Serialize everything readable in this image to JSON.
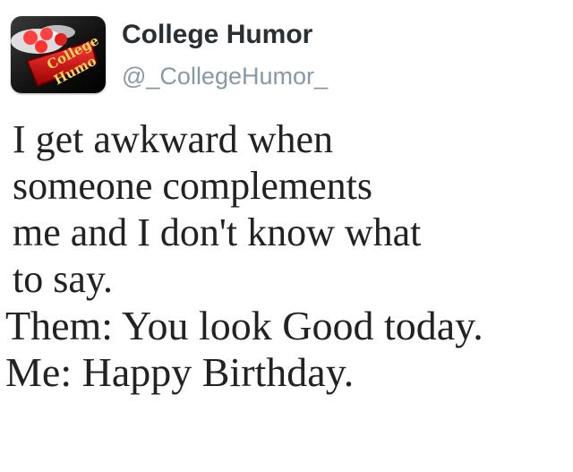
{
  "profile": {
    "display_name": "College Humor",
    "handle": "@_CollegeHumor_",
    "avatar_text": "College Humor",
    "avatar_icon": "college-humor-logo"
  },
  "tweet": {
    "lines": [
      "I get awkward when",
      "someone complements",
      "me and I don't know what",
      "to say.",
      "Them: You look Good today.",
      "Me: Happy  Birthday."
    ]
  },
  "colors": {
    "name": "#292f33",
    "handle": "#8899a6",
    "text": "#222222",
    "avatar_red": "#c8102e"
  }
}
